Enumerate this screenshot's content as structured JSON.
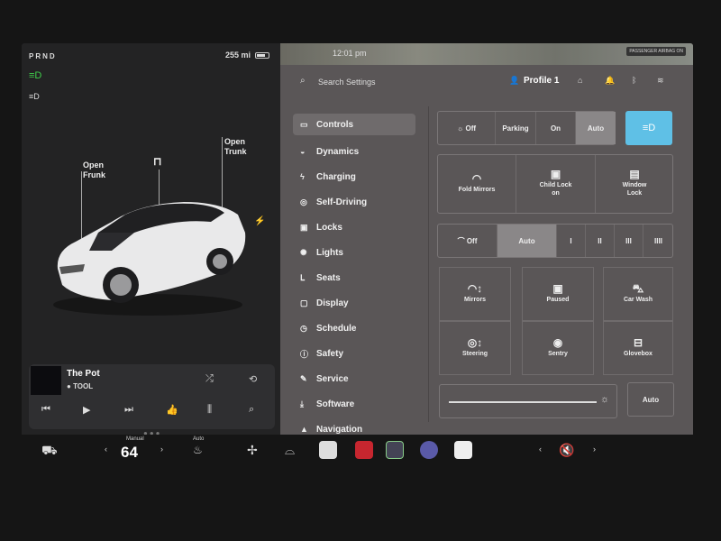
{
  "status": {
    "gear": "PRND",
    "range": "255 mi"
  },
  "car": {
    "frunk": "Open\nFrunk",
    "trunk": "Open\nTrunk"
  },
  "media": {
    "title": "The Pot",
    "artist": "TOOL"
  },
  "map": {
    "time": "12:01 pm",
    "passenger": "PASSENGER AIRBAG ON"
  },
  "topbar": {
    "search_placeholder": "Search Settings",
    "profile": "Profile 1"
  },
  "nav": [
    {
      "label": "Controls",
      "icon": "toggle-icon"
    },
    {
      "label": "Dynamics",
      "icon": "car-icon"
    },
    {
      "label": "Charging",
      "icon": "bolt-icon"
    },
    {
      "label": "Self-Driving",
      "icon": "steering-icon"
    },
    {
      "label": "Locks",
      "icon": "lock-icon"
    },
    {
      "label": "Lights",
      "icon": "sun-icon"
    },
    {
      "label": "Seats",
      "icon": "seat-icon"
    },
    {
      "label": "Display",
      "icon": "display-icon"
    },
    {
      "label": "Schedule",
      "icon": "clock-icon"
    },
    {
      "label": "Safety",
      "icon": "info-icon"
    },
    {
      "label": "Service",
      "icon": "wrench-icon"
    },
    {
      "label": "Software",
      "icon": "download-icon"
    },
    {
      "label": "Navigation",
      "icon": "nav-icon"
    }
  ],
  "headlights": {
    "options": [
      "Off",
      "Parking",
      "On",
      "Auto"
    ],
    "selected": "Auto"
  },
  "tiles_row1": [
    {
      "label": "Fold Mirrors",
      "sub": ""
    },
    {
      "label": "Child Lock",
      "sub": "on"
    },
    {
      "label": "Window",
      "sub": "Lock"
    }
  ],
  "wipers": {
    "options": [
      "Off",
      "Auto",
      "I",
      "II",
      "III",
      "IIII"
    ],
    "selected": "Auto"
  },
  "tiles_row2": [
    {
      "label": "Mirrors"
    },
    {
      "label": "Paused"
    },
    {
      "label": "Car Wash"
    },
    {
      "label": "Steering"
    },
    {
      "label": "Sentry"
    },
    {
      "label": "Glovebox"
    }
  ],
  "brightness": {
    "auto_label": "Auto"
  },
  "bottom": {
    "temp_mode": "Manual",
    "temp": "64",
    "seat_mode": "Auto"
  },
  "colors": {
    "accent": "#5fc0e6",
    "active_light": "#3fcf4a"
  }
}
